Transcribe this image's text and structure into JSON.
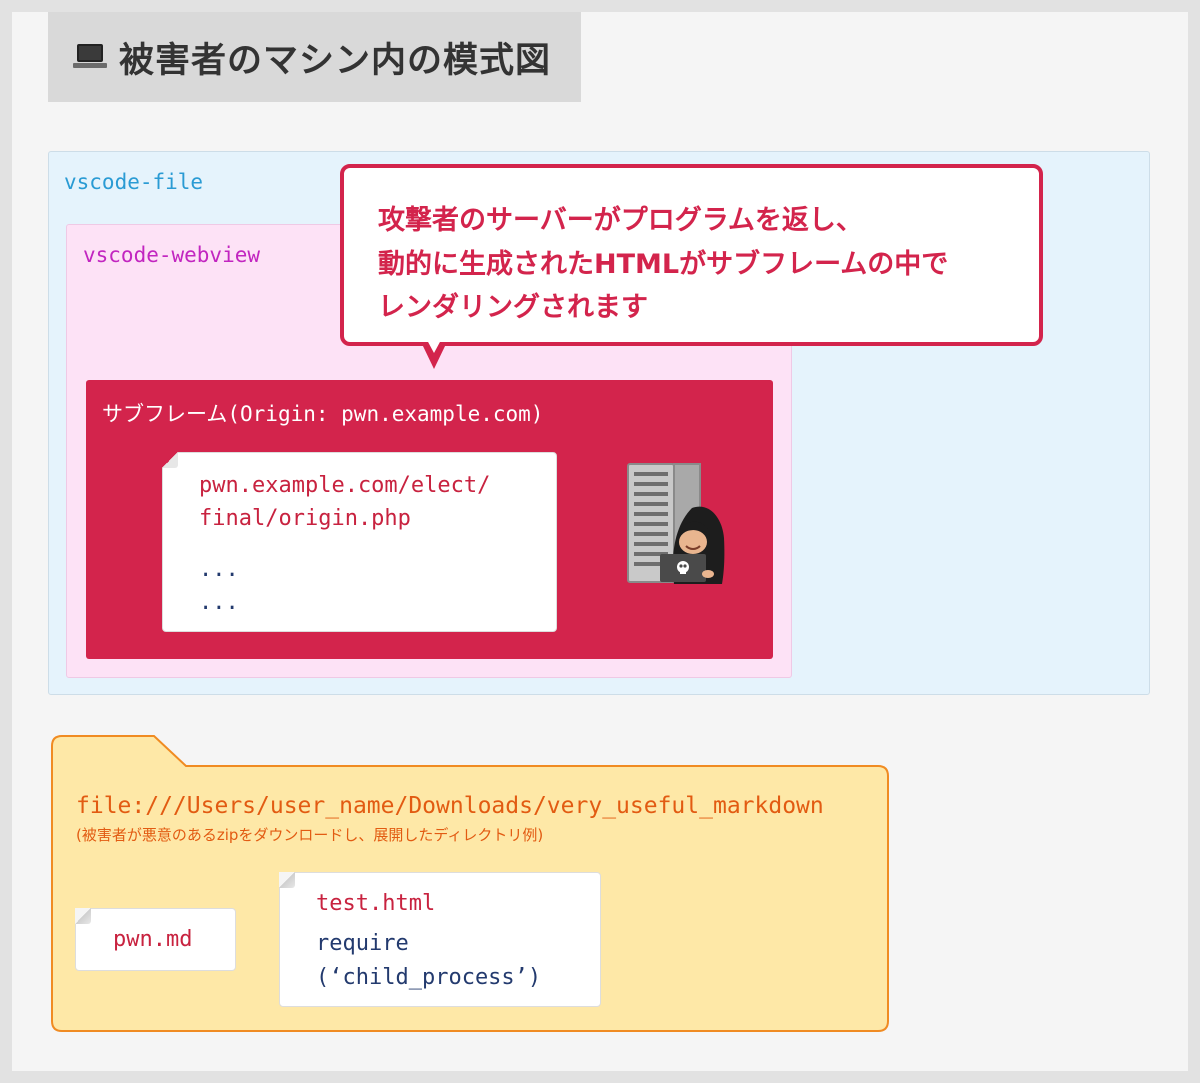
{
  "title": {
    "icon": "laptop-icon",
    "text": "被害者のマシン内の模式図"
  },
  "vscode_file": {
    "label": "vscode-file",
    "color": "#2a9bd4"
  },
  "vscode_webview": {
    "label": "vscode-webview",
    "color": "#c225c0"
  },
  "subframe": {
    "label": "サブフレーム(Origin: pwn.example.com)",
    "color": "#d3244c",
    "note": {
      "line1": "pwn.example.com/elect/",
      "line2": "final/origin.php",
      "dots1": "...",
      "dots2": "..."
    }
  },
  "callout": {
    "line1": "攻撃者のサーバーがプログラムを返し、",
    "line2": "動的に生成されたHTMLがサブフレームの中で",
    "line3": "レンダリングされます"
  },
  "attacker_icon": "hacker-with-server-icon",
  "folder": {
    "path": "file:///Users/user_name/Downloads/very_useful_markdown",
    "caption": "(被害者が悪意のあるzipをダウンロードし、展開したディレクトリ例)",
    "color": "#e25b12",
    "files": {
      "pwn": {
        "name": "pwn.md"
      },
      "test": {
        "name": "test.html",
        "code_line1": "require",
        "code_line2": "(‘child_process’)"
      }
    }
  }
}
